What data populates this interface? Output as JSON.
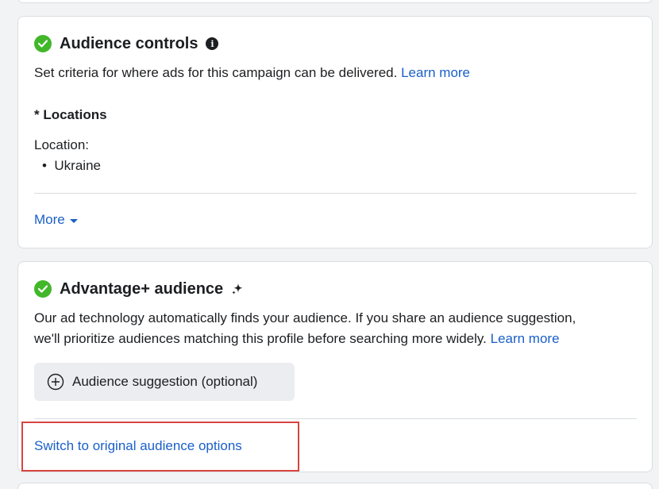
{
  "audience_controls": {
    "title": "Audience controls",
    "info_icon": "i",
    "description": "Set criteria for where ads for this campaign can be delivered.",
    "learn_more": "Learn more",
    "locations_heading": "* Locations",
    "location_label": "Location:",
    "location_items": [
      "Ukraine"
    ],
    "more_label": "More"
  },
  "advantage_audience": {
    "title": "Advantage+ audience",
    "description": "Our ad technology automatically finds your audience. If you share an audience suggestion,",
    "description_line2": "we'll prioritize audiences matching this profile before searching more widely.",
    "learn_more": "Learn more",
    "suggestion_button": "Audience suggestion (optional)",
    "switch_link": "Switch to original audience options"
  },
  "colors": {
    "link": "#1a5fc9",
    "check_green": "#42b72a",
    "highlight_red": "#d9443f"
  },
  "icons": [
    "check-circle-icon",
    "info-icon",
    "sparkle-icon",
    "caret-down-icon",
    "plus-circle-icon"
  ]
}
